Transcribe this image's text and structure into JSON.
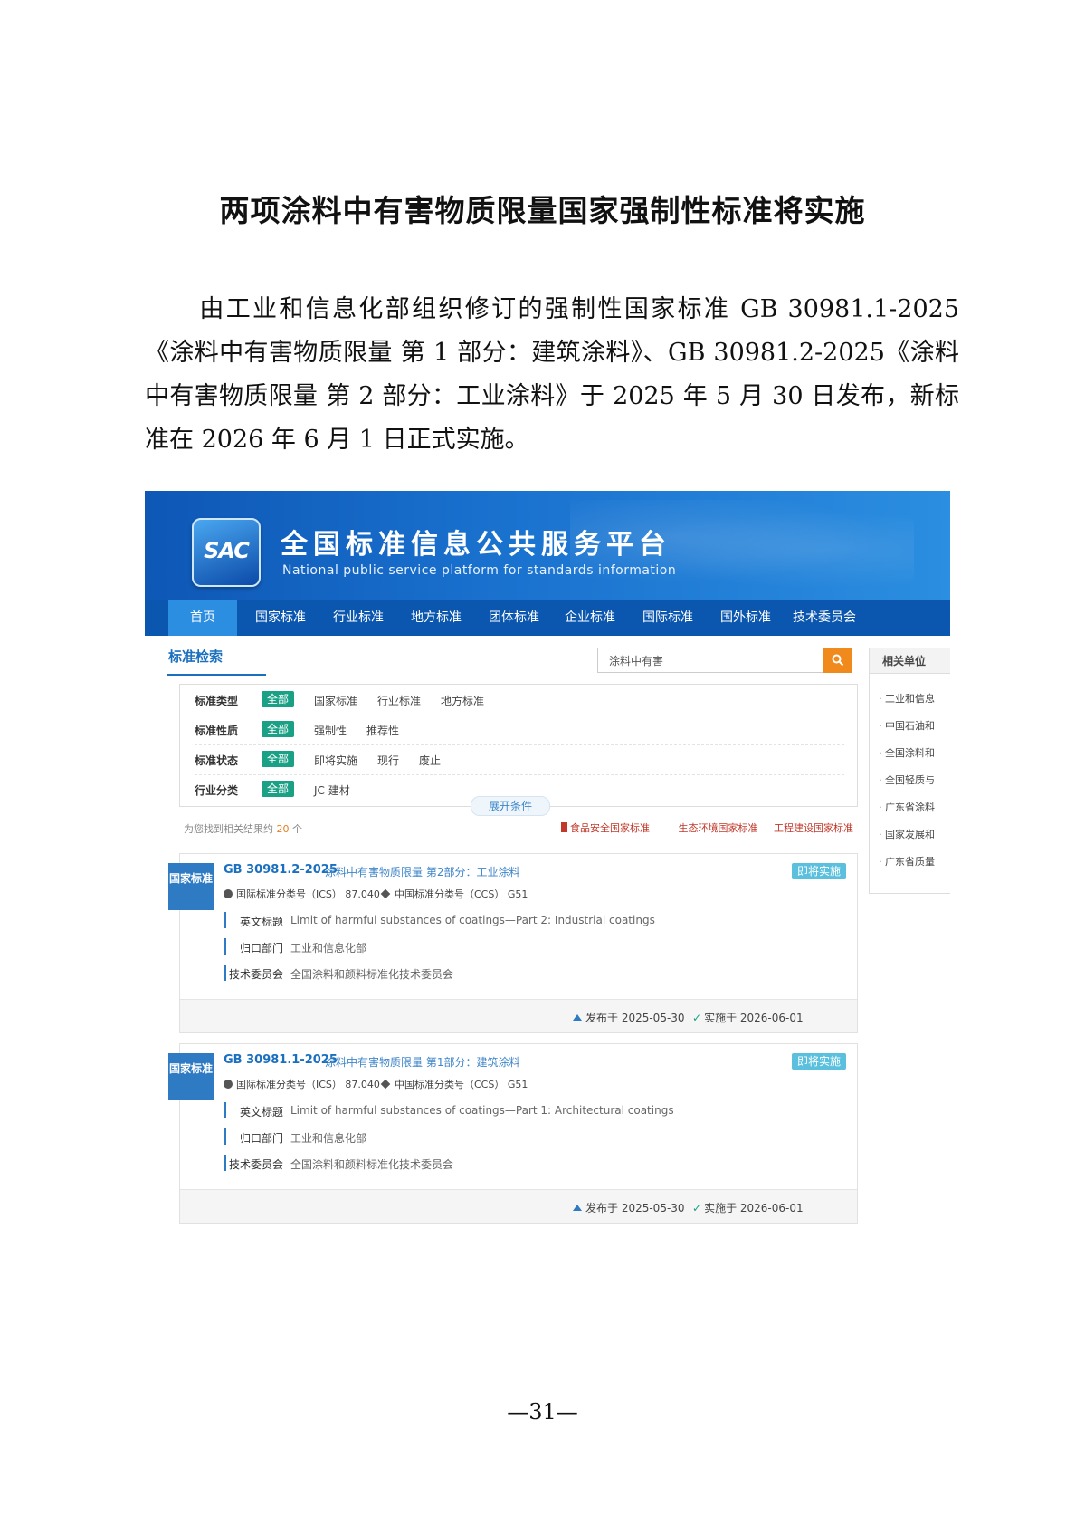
{
  "doc": {
    "title": "两项涂料中有害物质限量国家强制性标准将实施",
    "paragraph": "由工业和信息化部组织修订的强制性国家标准 GB 30981.1-2025《涂料中有害物质限量 第 1 部分：建筑涂料》、GB 30981.2-2025《涂料中有害物质限量 第 2 部分：工业涂料》于 2025 年 5 月 30 日发布，新标准在 2026 年 6 月 1 日正式实施。",
    "page_number": "—31—"
  },
  "site": {
    "logo_text": "SAC",
    "name": "全国标准信息公共服务平台",
    "subtitle": "National public service platform  for standards information"
  },
  "nav": [
    "首页",
    "国家标准",
    "行业标准",
    "地方标准",
    "团体标准",
    "企业标准",
    "国际标准",
    "国外标准",
    "技术委员会"
  ],
  "search": {
    "tab_label": "标准检索",
    "query": "涂料中有害"
  },
  "filters": [
    {
      "label": "标准类型",
      "all": "全部",
      "options": [
        "国家标准",
        "行业标准",
        "地方标准"
      ]
    },
    {
      "label": "标准性质",
      "all": "全部",
      "options": [
        "强制性",
        "推荐性"
      ]
    },
    {
      "label": "标准状态",
      "all": "全部",
      "options": [
        "即将实施",
        "现行",
        "废止"
      ]
    },
    {
      "label": "行业分类",
      "all": "全部",
      "options": [
        "JC 建材"
      ]
    }
  ],
  "expand_label": "展开条件",
  "result_prefix": "为您找到相关结果约",
  "result_count": "20",
  "result_suffix": "个",
  "quick_links": [
    "食品安全国家标准",
    "生态环境国家标准",
    "工程建设国家标准"
  ],
  "side": {
    "title": "相关单位",
    "items": [
      "· 工业和信息",
      "· 中国石油和",
      "· 全国涂料和",
      "· 全国轻质与",
      "· 广东省涂料",
      "· 国家发展和",
      "· 广东省质量"
    ]
  },
  "results": [
    {
      "tag": "国家标准",
      "code": "GB 30981.2-2025",
      "name": "涂料中有害物质限量 第2部分：工业涂料",
      "badge": "即将实施",
      "ics": "国际标准分类号（ICS） 87.040",
      "ccs": "中国标准分类号（CCS） G51",
      "en_label": "英文标题",
      "en_title": "Limit of harmful substances of coatings—Part 2: Industrial coatings",
      "dept_label": "归口部门",
      "dept": "工业和信息化部",
      "tc_label": "技术委员会",
      "tc": "全国涂料和颜料标准化技术委员会",
      "published": "发布于 2025-05-30",
      "effective": "实施于 2026-06-01"
    },
    {
      "tag": "国家标准",
      "code": "GB 30981.1-2025",
      "name": "涂料中有害物质限量 第1部分：建筑涂料",
      "badge": "即将实施",
      "ics": "国际标准分类号（ICS） 87.040",
      "ccs": "中国标准分类号（CCS） G51",
      "en_label": "英文标题",
      "en_title": "Limit of harmful substances of coatings—Part 1: Architectural coatings",
      "dept_label": "归口部门",
      "dept": "工业和信息化部",
      "tc_label": "技术委员会",
      "tc": "全国涂料和颜料标准化技术委员会",
      "published": "发布于 2025-05-30",
      "effective": "实施于 2026-06-01"
    }
  ]
}
